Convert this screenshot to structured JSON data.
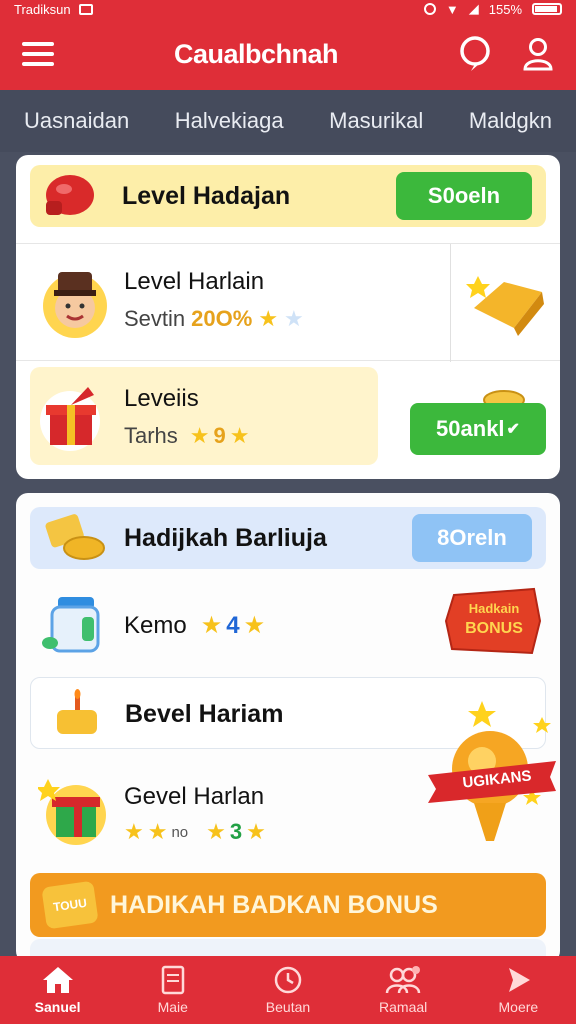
{
  "status": {
    "carrier": "Tradiksun",
    "battery": "155%"
  },
  "header": {
    "title": "Caualbchnah"
  },
  "tabs": [
    "Uasnaidan",
    "Halvekiaga",
    "Masurikal",
    "Maldgkn"
  ],
  "card1": {
    "banner": {
      "label": "Level Hadajan",
      "button": "S0oeln"
    },
    "row1": {
      "label": "Level Harlain",
      "sub": "Sevtin",
      "percent": "20O%"
    },
    "row2": {
      "label": "Leveiis",
      "sub": "Tarhs",
      "count": "9",
      "button": "50ankl"
    }
  },
  "card2": {
    "banner": {
      "label": "Hadijkah Barliuja",
      "button": "8Oreln"
    },
    "row1": {
      "label": "Kemo",
      "count": "4",
      "badge_line1": "Hadkain",
      "badge_line2": "BONUS"
    },
    "row2": {
      "label": "Bevel Hariam"
    },
    "row3": {
      "label": "Gevel Harlan",
      "small": "no",
      "count": "3",
      "ribbon": "UGIKANS"
    },
    "bonus": {
      "label": "HADIKAH BADKAN BONUS",
      "tag": "TOUU"
    }
  },
  "nav": [
    {
      "label": "Sanuel",
      "icon": "home-icon"
    },
    {
      "label": "Maie",
      "icon": "document-icon"
    },
    {
      "label": "Beutan",
      "icon": "clock-icon"
    },
    {
      "label": "Ramaal",
      "icon": "users-icon"
    },
    {
      "label": "Moere",
      "icon": "share-icon"
    }
  ],
  "colors": {
    "brand": "#df2e38",
    "green": "#3cb83c",
    "banner_yellow": "#fdeea9",
    "bonus_orange": "#f29a1f"
  }
}
